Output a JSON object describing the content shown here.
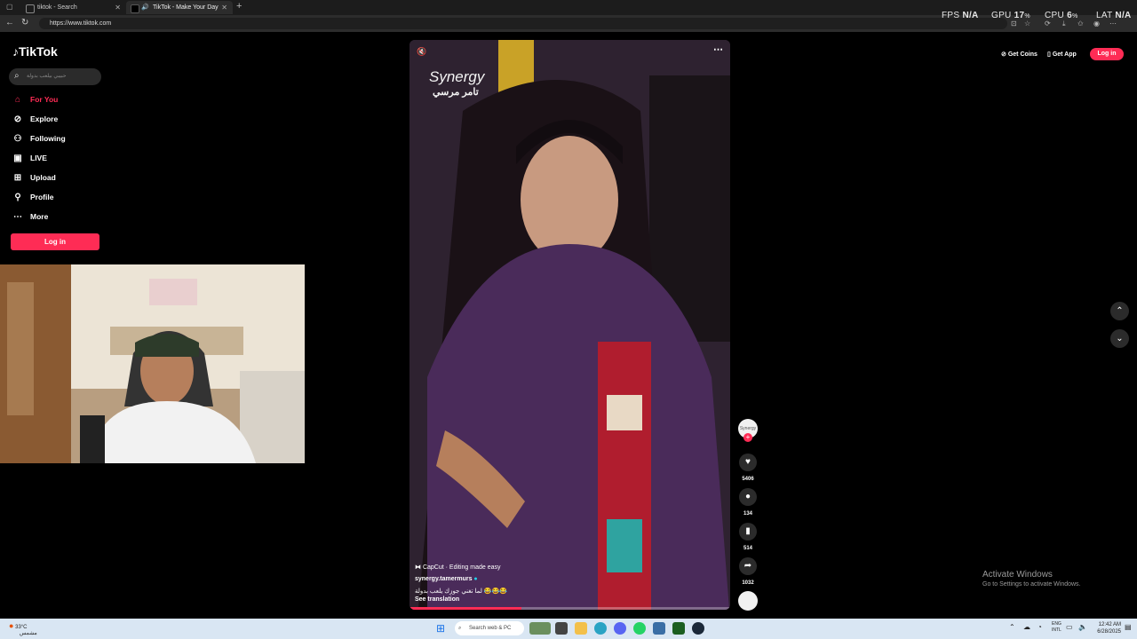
{
  "browser": {
    "tabs": [
      {
        "title": "tiktok - Search",
        "active": false
      },
      {
        "title": "TikTok - Make Your Day",
        "active": true
      }
    ],
    "url": "https://www.tiktok.com"
  },
  "overlay": {
    "fps_label": "FPS",
    "fps_value": "N/A",
    "gpu_label": "GPU",
    "gpu_value": "17",
    "gpu_unit": "%",
    "cpu_label": "CPU",
    "cpu_value": "6",
    "cpu_unit": "%",
    "lat_label": "LAT",
    "lat_value": "N/A"
  },
  "sidebar": {
    "logo": "TikTok",
    "search_placeholder": "حبيبي بيلعب بدولة",
    "items": [
      {
        "label": "For You",
        "icon": "home-icon",
        "active": true
      },
      {
        "label": "Explore",
        "icon": "compass-icon",
        "active": false
      },
      {
        "label": "Following",
        "icon": "users-icon",
        "active": false
      },
      {
        "label": "LIVE",
        "icon": "live-icon",
        "active": false
      },
      {
        "label": "Upload",
        "icon": "upload-icon",
        "active": false
      },
      {
        "label": "Profile",
        "icon": "profile-icon",
        "active": false
      },
      {
        "label": "More",
        "icon": "more-icon",
        "active": false
      }
    ],
    "login_label": "Log in"
  },
  "video": {
    "watermark_brand": "Synergy",
    "watermark_arabic": "تامر مرسي",
    "capcut": "CapCut · Editing made easy",
    "author": "synergy.tamermurs",
    "caption": "لما تغني جوزك يلعب بدولة 😂😂😂",
    "see_translation": "See translation",
    "progress": 0.35
  },
  "actions": {
    "avatar_label": "Synergy",
    "likes": "5406",
    "comments": "134",
    "saves": "514",
    "shares": "1032"
  },
  "topright": {
    "get_coins": "Get Coins",
    "get_app": "Get App",
    "login": "Log in"
  },
  "windows_notice": {
    "title": "Activate Windows",
    "subtitle": "Go to Settings to activate Windows."
  },
  "taskbar": {
    "weather_temp": "33°C",
    "weather_desc": "مشمس",
    "search_placeholder": "Search web & PC",
    "lang_top": "ENG",
    "lang_bottom": "INTL",
    "time": "12:42 AM",
    "date": "6/28/2025"
  },
  "colors": {
    "accent": "#fe2c55",
    "background": "#000000",
    "taskbar": "#d9e6f3"
  }
}
